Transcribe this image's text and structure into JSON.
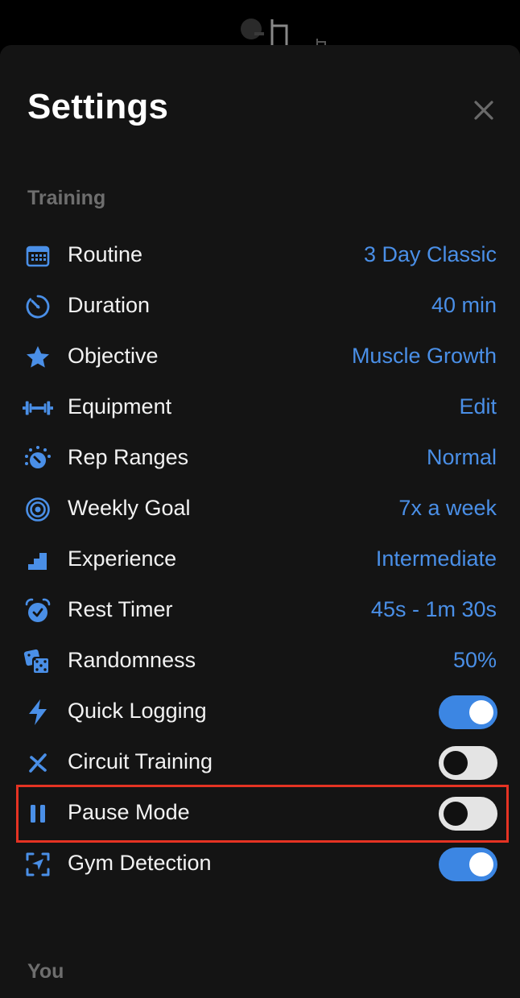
{
  "header": {
    "title": "Settings",
    "close_icon": "close-icon"
  },
  "colors": {
    "accent": "#4a8fe7",
    "toggle_on": "#3c86e3",
    "highlight": "#e53323",
    "sheet_background": "#141414"
  },
  "training": {
    "section_label": "Training",
    "rows": [
      {
        "icon": "calendar-icon",
        "label": "Routine",
        "value": "3 Day Classic"
      },
      {
        "icon": "timer-icon",
        "label": "Duration",
        "value": "40 min"
      },
      {
        "icon": "star-icon",
        "label": "Objective",
        "value": "Muscle Growth"
      },
      {
        "icon": "dumbbell-icon",
        "label": "Equipment",
        "value": "Edit"
      },
      {
        "icon": "gauge-icon",
        "label": "Rep Ranges",
        "value": "Normal"
      },
      {
        "icon": "target-icon",
        "label": "Weekly Goal",
        "value": "7x a week"
      },
      {
        "icon": "stairs-icon",
        "label": "Experience",
        "value": "Intermediate"
      },
      {
        "icon": "alarm-clock-icon",
        "label": "Rest Timer",
        "value": "45s - 1m 30s"
      },
      {
        "icon": "dice-icon",
        "label": "Randomness",
        "value": "50%"
      },
      {
        "icon": "lightning-icon",
        "label": "Quick Logging",
        "toggle": true
      },
      {
        "icon": "percent-icon",
        "label": "Circuit Training",
        "toggle": false
      },
      {
        "icon": "pause-icon",
        "label": "Pause Mode",
        "toggle": false
      },
      {
        "icon": "location-scan-icon",
        "label": "Gym Detection",
        "toggle": true
      }
    ]
  },
  "you": {
    "section_label": "You"
  }
}
